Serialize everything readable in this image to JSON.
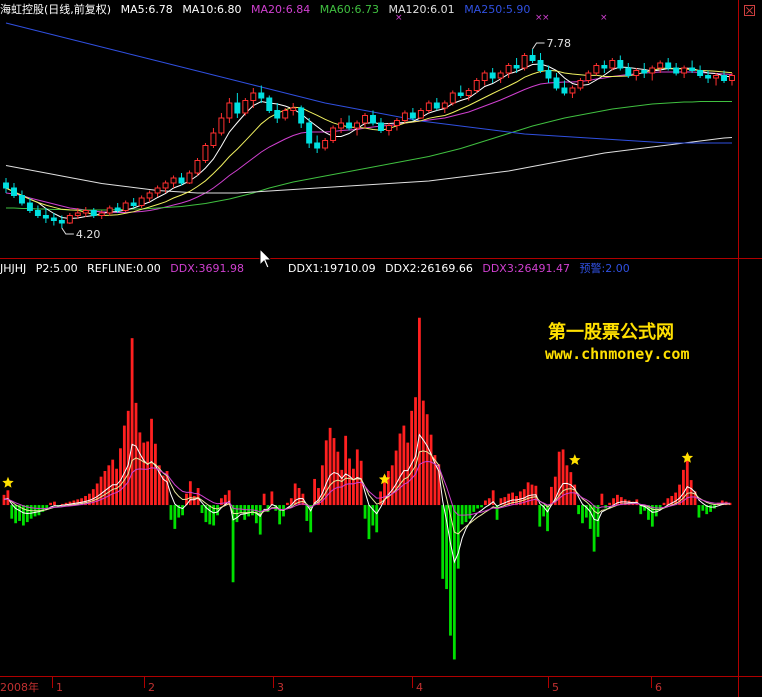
{
  "main_panel": {
    "title": "海虹控股(日线,前复权)",
    "ma": [
      {
        "label": "MA5:6.78",
        "color": "#ffffff"
      },
      {
        "label": "MA10:6.80",
        "color": "#ffffff"
      },
      {
        "label": "MA20:6.84",
        "color": "#d040d0"
      },
      {
        "label": "MA60:6.73",
        "color": "#40c040"
      },
      {
        "label": "MA120:6.01",
        "color": "#e0e0e0"
      },
      {
        "label": "MA250:5.90",
        "color": "#3050e0"
      }
    ],
    "high_marker": "7.78",
    "low_marker": "4.20"
  },
  "sub_panel": {
    "labels_left": [
      {
        "label": "JHJHJ",
        "color": "#ffffff"
      },
      {
        "label": "P2:5.00",
        "color": "#ffffff"
      },
      {
        "label": "REFLINE:0.00",
        "color": "#ffffff"
      },
      {
        "label": "DDX:3691.98",
        "color": "#d040d0"
      }
    ],
    "labels_right": [
      {
        "label": "DDX1:19710.09",
        "color": "#ffffff"
      },
      {
        "label": "DDX2:26169.66",
        "color": "#ffffff"
      },
      {
        "label": "DDX3:26491.47",
        "color": "#d040d0"
      },
      {
        "label": "预警:2.00",
        "color": "#3050e0"
      }
    ]
  },
  "watermark": {
    "line1": "第一股票公式网",
    "line2": "www.chnmoney.com",
    "color": "#ffe000"
  },
  "x_axis": {
    "year_label": "2008年",
    "month_labels": [
      "1",
      "2",
      "3",
      "4",
      "5",
      "6"
    ]
  },
  "colors": {
    "up": "#ff3030",
    "down": "#00e0e0",
    "pos_bar": "#ff2020",
    "neg_bar": "#00e000",
    "separator": "#b00000"
  },
  "chart_data": [
    {
      "type": "candlestick",
      "title": "海虹控股(日线,前复权)",
      "ylim": [
        3.8,
        8.4
      ],
      "annotations": [
        {
          "text": "7.78",
          "value": 7.78
        },
        {
          "text": "4.20",
          "value": 4.2
        }
      ],
      "ohlc": [
        [
          5.1,
          5.2,
          4.9,
          5.0
        ],
        [
          5.0,
          5.1,
          4.8,
          4.85
        ],
        [
          4.85,
          4.95,
          4.65,
          4.7
        ],
        [
          4.7,
          4.8,
          4.5,
          4.55
        ],
        [
          4.55,
          4.65,
          4.4,
          4.45
        ],
        [
          4.45,
          4.6,
          4.3,
          4.4
        ],
        [
          4.4,
          4.5,
          4.25,
          4.35
        ],
        [
          4.35,
          4.45,
          4.2,
          4.3
        ],
        [
          4.3,
          4.5,
          4.28,
          4.45
        ],
        [
          4.45,
          4.6,
          4.38,
          4.5
        ],
        [
          4.5,
          4.62,
          4.42,
          4.55
        ],
        [
          4.55,
          4.6,
          4.4,
          4.45
        ],
        [
          4.45,
          4.55,
          4.38,
          4.5
        ],
        [
          4.5,
          4.65,
          4.45,
          4.6
        ],
        [
          4.6,
          4.7,
          4.5,
          4.55
        ],
        [
          4.55,
          4.75,
          4.52,
          4.7
        ],
        [
          4.7,
          4.8,
          4.6,
          4.65
        ],
        [
          4.65,
          4.85,
          4.6,
          4.8
        ],
        [
          4.8,
          4.95,
          4.72,
          4.9
        ],
        [
          4.9,
          5.05,
          4.82,
          5.0
        ],
        [
          5.0,
          5.15,
          4.9,
          5.1
        ],
        [
          5.1,
          5.25,
          5.0,
          5.2
        ],
        [
          5.2,
          5.3,
          5.05,
          5.1
        ],
        [
          5.1,
          5.35,
          5.08,
          5.3
        ],
        [
          5.3,
          5.6,
          5.25,
          5.55
        ],
        [
          5.55,
          5.9,
          5.5,
          5.85
        ],
        [
          5.85,
          6.2,
          5.8,
          6.1
        ],
        [
          6.1,
          6.5,
          6.05,
          6.4
        ],
        [
          6.4,
          6.8,
          6.3,
          6.7
        ],
        [
          6.7,
          6.9,
          6.4,
          6.5
        ],
        [
          6.5,
          6.8,
          6.45,
          6.75
        ],
        [
          6.75,
          7.0,
          6.6,
          6.9
        ],
        [
          6.9,
          7.05,
          6.7,
          6.8
        ],
        [
          6.8,
          6.85,
          6.5,
          6.55
        ],
        [
          6.55,
          6.7,
          6.3,
          6.4
        ],
        [
          6.4,
          6.6,
          6.35,
          6.55
        ],
        [
          6.55,
          6.7,
          6.45,
          6.6
        ],
        [
          6.6,
          6.65,
          6.2,
          6.3
        ],
        [
          6.3,
          6.4,
          5.8,
          5.9
        ],
        [
          5.9,
          6.05,
          5.7,
          5.8
        ],
        [
          5.8,
          6.0,
          5.75,
          5.95
        ],
        [
          5.95,
          6.25,
          5.9,
          6.2
        ],
        [
          6.2,
          6.4,
          6.1,
          6.3
        ],
        [
          6.3,
          6.45,
          6.15,
          6.2
        ],
        [
          6.2,
          6.35,
          6.05,
          6.3
        ],
        [
          6.3,
          6.5,
          6.2,
          6.45
        ],
        [
          6.45,
          6.55,
          6.25,
          6.3
        ],
        [
          6.3,
          6.4,
          6.1,
          6.15
        ],
        [
          6.15,
          6.3,
          6.05,
          6.25
        ],
        [
          6.25,
          6.4,
          6.15,
          6.35
        ],
        [
          6.35,
          6.55,
          6.3,
          6.5
        ],
        [
          6.5,
          6.6,
          6.35,
          6.4
        ],
        [
          6.4,
          6.6,
          6.38,
          6.55
        ],
        [
          6.55,
          6.75,
          6.5,
          6.7
        ],
        [
          6.7,
          6.8,
          6.55,
          6.6
        ],
        [
          6.6,
          6.75,
          6.5,
          6.7
        ],
        [
          6.7,
          6.95,
          6.65,
          6.9
        ],
        [
          6.9,
          7.05,
          6.8,
          6.85
        ],
        [
          6.85,
          7.0,
          6.75,
          6.95
        ],
        [
          6.95,
          7.2,
          6.9,
          7.15
        ],
        [
          7.15,
          7.35,
          7.05,
          7.3
        ],
        [
          7.3,
          7.4,
          7.1,
          7.2
        ],
        [
          7.2,
          7.35,
          7.1,
          7.3
        ],
        [
          7.3,
          7.5,
          7.2,
          7.45
        ],
        [
          7.45,
          7.6,
          7.3,
          7.4
        ],
        [
          7.4,
          7.7,
          7.35,
          7.65
        ],
        [
          7.65,
          7.78,
          7.5,
          7.55
        ],
        [
          7.55,
          7.7,
          7.3,
          7.35
        ],
        [
          7.35,
          7.45,
          7.1,
          7.2
        ],
        [
          7.2,
          7.3,
          6.95,
          7.0
        ],
        [
          7.0,
          7.15,
          6.85,
          6.9
        ],
        [
          6.9,
          7.05,
          6.8,
          7.0
        ],
        [
          7.0,
          7.2,
          6.95,
          7.15
        ],
        [
          7.15,
          7.35,
          7.1,
          7.3
        ],
        [
          7.3,
          7.5,
          7.25,
          7.45
        ],
        [
          7.45,
          7.55,
          7.3,
          7.4
        ],
        [
          7.4,
          7.6,
          7.35,
          7.55
        ],
        [
          7.55,
          7.65,
          7.35,
          7.4
        ],
        [
          7.4,
          7.5,
          7.2,
          7.25
        ],
        [
          7.25,
          7.4,
          7.15,
          7.35
        ],
        [
          7.35,
          7.5,
          7.2,
          7.3
        ],
        [
          7.3,
          7.45,
          7.15,
          7.4
        ],
        [
          7.4,
          7.55,
          7.3,
          7.5
        ],
        [
          7.5,
          7.6,
          7.35,
          7.4
        ],
        [
          7.4,
          7.5,
          7.25,
          7.3
        ],
        [
          7.3,
          7.45,
          7.2,
          7.4
        ],
        [
          7.4,
          7.55,
          7.3,
          7.35
        ],
        [
          7.35,
          7.45,
          7.2,
          7.25
        ],
        [
          7.25,
          7.35,
          7.1,
          7.2
        ],
        [
          7.2,
          7.3,
          7.05,
          7.25
        ],
        [
          7.25,
          7.35,
          7.1,
          7.15
        ],
        [
          7.15,
          7.3,
          7.05,
          7.25
        ]
      ],
      "ma_series": [
        {
          "name": "MA20",
          "color": "#d040d0",
          "values": [
            4.9,
            4.88,
            4.85,
            4.8,
            4.76,
            4.72,
            4.68,
            4.64,
            4.6,
            4.58,
            4.56,
            4.54,
            4.52,
            4.52,
            4.51,
            4.51,
            4.52,
            4.53,
            4.55,
            4.58,
            4.62,
            4.66,
            4.7,
            4.75,
            4.82,
            4.9,
            5.0,
            5.12,
            5.25,
            5.36,
            5.48,
            5.6,
            5.72,
            5.82,
            5.9,
            5.98,
            6.05,
            6.1,
            6.12,
            6.12,
            6.12,
            6.13,
            6.15,
            6.16,
            6.17,
            6.2,
            6.22,
            6.24,
            6.25,
            6.27,
            6.3,
            6.32,
            6.34,
            6.36,
            6.38,
            6.4,
            6.44,
            6.48,
            6.52,
            6.58,
            6.64,
            6.7,
            6.76,
            6.83,
            6.9,
            6.97,
            7.03,
            7.08,
            7.1,
            7.11,
            7.12,
            7.12,
            7.13,
            7.15,
            7.18,
            7.2,
            7.23,
            7.25,
            7.27,
            7.28,
            7.3,
            7.31,
            7.32,
            7.32,
            7.32,
            7.32,
            7.32,
            7.31,
            7.3,
            7.29,
            7.28,
            7.27
          ]
        },
        {
          "name": "MA60",
          "color": "#40c040",
          "values": [
            4.6,
            4.6,
            4.59,
            4.59,
            4.58,
            4.58,
            4.57,
            4.57,
            4.56,
            4.56,
            4.56,
            4.56,
            4.56,
            4.56,
            4.57,
            4.57,
            4.58,
            4.58,
            4.59,
            4.6,
            4.61,
            4.62,
            4.63,
            4.65,
            4.67,
            4.69,
            4.72,
            4.75,
            4.78,
            4.82,
            4.86,
            4.9,
            4.95,
            5.0,
            5.04,
            5.08,
            5.12,
            5.15,
            5.18,
            5.21,
            5.24,
            5.27,
            5.3,
            5.33,
            5.36,
            5.39,
            5.42,
            5.45,
            5.48,
            5.51,
            5.54,
            5.57,
            5.6,
            5.63,
            5.67,
            5.71,
            5.75,
            5.79,
            5.84,
            5.89,
            5.94,
            5.99,
            6.04,
            6.09,
            6.14,
            6.19,
            6.24,
            6.28,
            6.32,
            6.36,
            6.4,
            6.43,
            6.46,
            6.49,
            6.52,
            6.55,
            6.58,
            6.6,
            6.62,
            6.64,
            6.66,
            6.68,
            6.69,
            6.7,
            6.71,
            6.72,
            6.72,
            6.73,
            6.73,
            6.73,
            6.73,
            6.73
          ]
        },
        {
          "name": "MA120",
          "color": "#e0e0e0",
          "values": [
            5.45,
            5.42,
            5.39,
            5.36,
            5.33,
            5.3,
            5.27,
            5.24,
            5.21,
            5.18,
            5.15,
            5.12,
            5.09,
            5.07,
            5.05,
            5.03,
            5.01,
            4.99,
            4.97,
            4.95,
            4.94,
            4.93,
            4.92,
            4.91,
            4.9,
            4.9,
            4.9,
            4.9,
            4.9,
            4.9,
            4.91,
            4.92,
            4.93,
            4.94,
            4.95,
            4.96,
            4.97,
            4.98,
            4.99,
            5.0,
            5.01,
            5.02,
            5.03,
            5.04,
            5.05,
            5.06,
            5.07,
            5.08,
            5.09,
            5.1,
            5.11,
            5.12,
            5.13,
            5.14,
            5.16,
            5.18,
            5.2,
            5.22,
            5.24,
            5.26,
            5.28,
            5.3,
            5.32,
            5.34,
            5.37,
            5.4,
            5.43,
            5.46,
            5.49,
            5.52,
            5.55,
            5.58,
            5.61,
            5.64,
            5.67,
            5.7,
            5.72,
            5.74,
            5.76,
            5.78,
            5.8,
            5.82,
            5.84,
            5.86,
            5.88,
            5.9,
            5.92,
            5.94,
            5.96,
            5.98,
            6.0,
            6.01
          ]
        },
        {
          "name": "MA250",
          "color": "#3050e0",
          "values": [
            8.3,
            8.26,
            8.22,
            8.18,
            8.14,
            8.1,
            8.06,
            8.02,
            7.98,
            7.94,
            7.9,
            7.86,
            7.82,
            7.78,
            7.74,
            7.7,
            7.66,
            7.62,
            7.58,
            7.54,
            7.5,
            7.46,
            7.42,
            7.38,
            7.34,
            7.3,
            7.26,
            7.22,
            7.18,
            7.14,
            7.1,
            7.06,
            7.02,
            6.98,
            6.94,
            6.9,
            6.86,
            6.82,
            6.78,
            6.74,
            6.7,
            6.67,
            6.64,
            6.61,
            6.58,
            6.55,
            6.52,
            6.49,
            6.46,
            6.43,
            6.4,
            6.37,
            6.34,
            6.32,
            6.3,
            6.28,
            6.26,
            6.24,
            6.22,
            6.2,
            6.18,
            6.16,
            6.14,
            6.12,
            6.1,
            6.08,
            6.07,
            6.06,
            6.05,
            6.04,
            6.03,
            6.02,
            6.01,
            6.0,
            5.99,
            5.98,
            5.97,
            5.96,
            5.95,
            5.94,
            5.93,
            5.92,
            5.91,
            5.9,
            5.9,
            5.9,
            5.9,
            5.9,
            5.9,
            5.9,
            5.9,
            5.9
          ]
        }
      ]
    },
    {
      "type": "bar",
      "ylim": [
        -14000,
        20000
      ],
      "values": [
        900,
        1300,
        -1200,
        -1600,
        -1400,
        -1800,
        -1500,
        -1200,
        -1000,
        -900,
        -600,
        -400,
        200,
        300,
        -200,
        100,
        200,
        300,
        400,
        500,
        600,
        800,
        1000,
        1400,
        1900,
        2500,
        3000,
        3500,
        4000,
        3200,
        5000,
        7000,
        8300,
        14700,
        9000,
        6400,
        5500,
        5600,
        7600,
        5400,
        3500,
        2600,
        3000,
        -1300,
        -2100,
        -1100,
        -900,
        1000,
        2100,
        800,
        1500,
        -700,
        -1500,
        -1700,
        -1800,
        -900,
        600,
        900,
        1300,
        -6800,
        -1500,
        -700,
        -1300,
        -1000,
        -900,
        -1600,
        -2600,
        1000,
        -600,
        1200,
        -500,
        -1700,
        -1000,
        200,
        600,
        1900,
        1500,
        1000,
        -1400,
        -2400,
        2300,
        1500,
        3500,
        5700,
        6800,
        5900,
        4700,
        3100,
        6100,
        4100,
        3200,
        4900,
        3900,
        -1200,
        -3000,
        -1800,
        -2400,
        1200,
        2600,
        3000,
        3500,
        4800,
        6300,
        7000,
        5500,
        8300,
        9500,
        16500,
        9200,
        8000,
        6200,
        4400,
        3600,
        -6500,
        -7400,
        -11500,
        -13600,
        -5600,
        -1700,
        -1500,
        -1200,
        -600,
        -300,
        -200,
        400,
        600,
        1300,
        -1300,
        600,
        700,
        1000,
        1100,
        800,
        1200,
        1400,
        2000,
        1800,
        1700,
        -1900,
        -1000,
        -2300,
        1600,
        2500,
        4700,
        4900,
        3500,
        2900,
        1800,
        -800,
        -1600,
        -1100,
        -2100,
        -4100,
        -2800,
        1000,
        -300,
        200,
        600,
        900,
        700,
        500,
        400,
        300,
        500,
        -800,
        -500,
        -1300,
        -1900,
        -1000,
        -400,
        200,
        600,
        800,
        1100,
        1800,
        3100,
        4500,
        2200,
        1200,
        -1100,
        -500,
        -800,
        -600,
        -300,
        200,
        400,
        300,
        200
      ]
    }
  ]
}
